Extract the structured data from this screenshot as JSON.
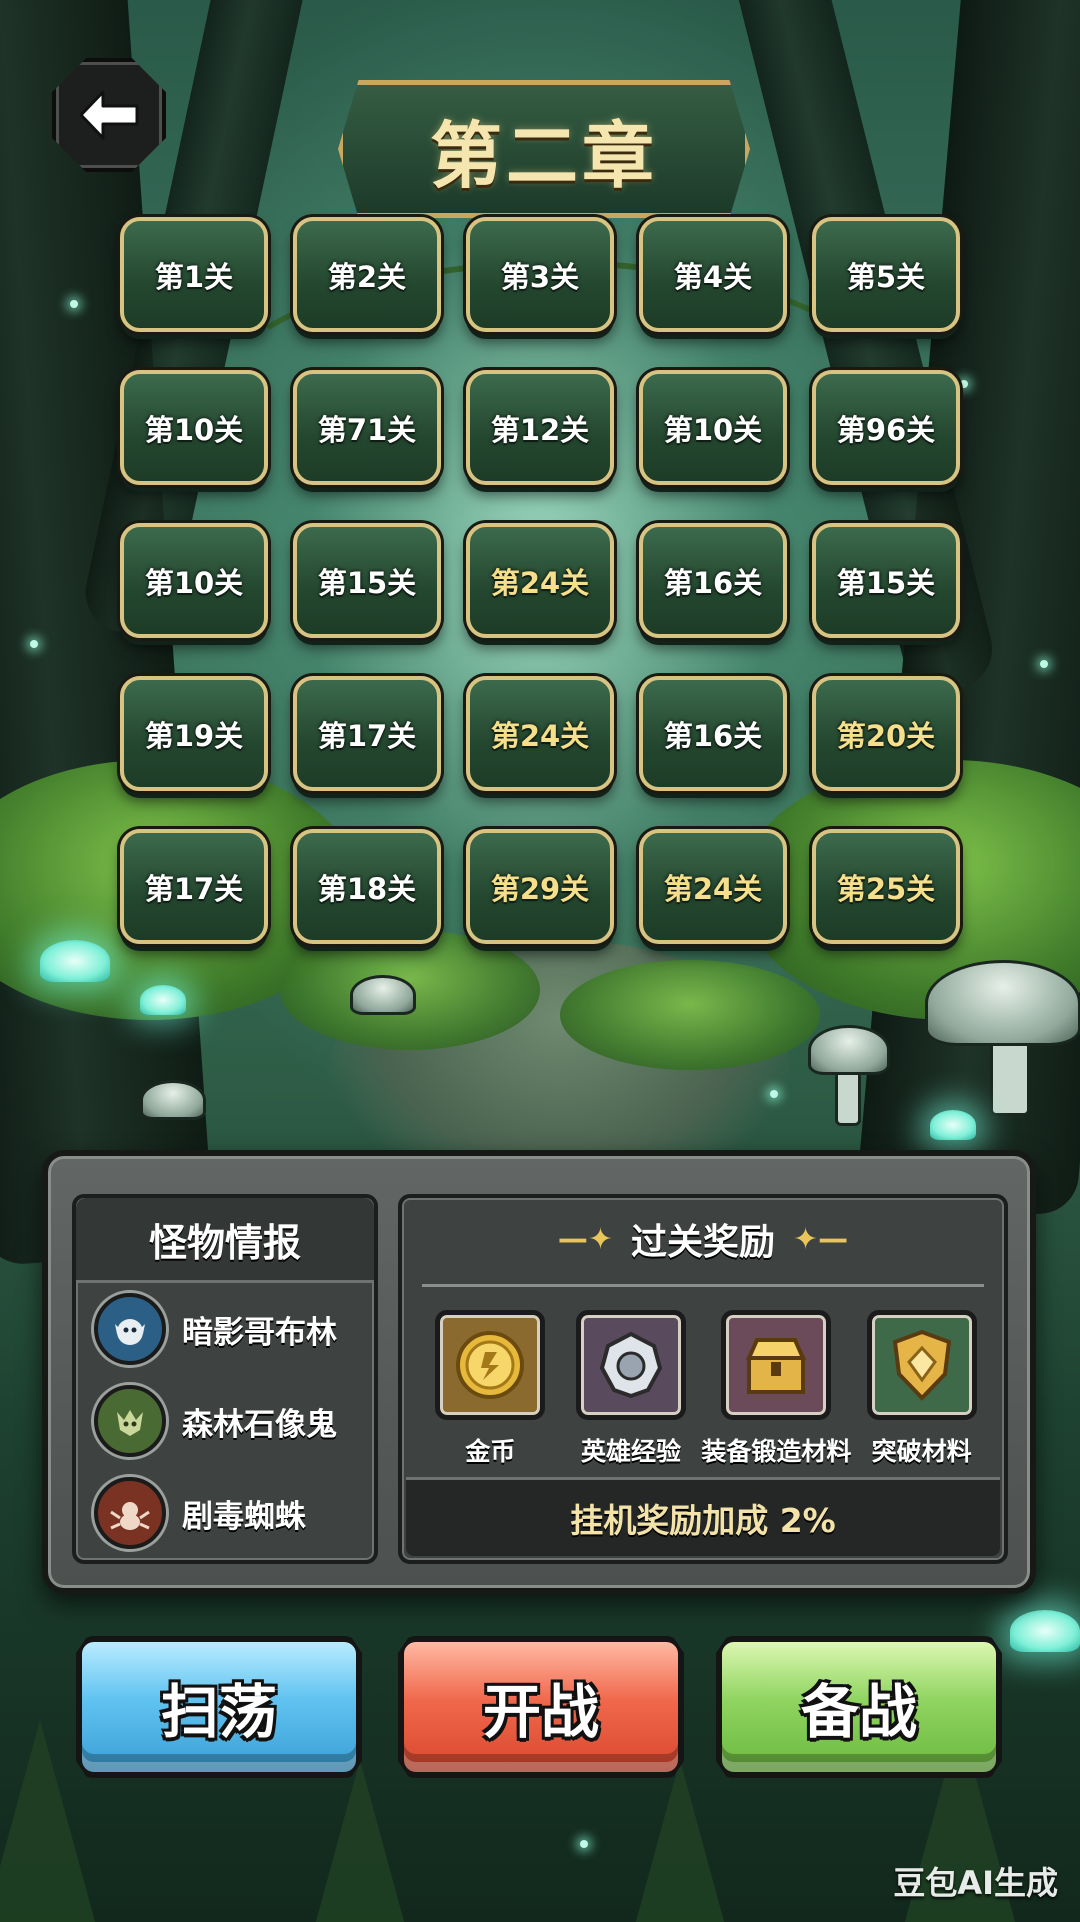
{
  "chapter": {
    "title": "第二章"
  },
  "levels": [
    {
      "label": "第1关",
      "gold": false
    },
    {
      "label": "第2关",
      "gold": false
    },
    {
      "label": "第3关",
      "gold": false
    },
    {
      "label": "第4关",
      "gold": false
    },
    {
      "label": "第5关",
      "gold": false
    },
    {
      "label": "第10关",
      "gold": false
    },
    {
      "label": "第71关",
      "gold": false
    },
    {
      "label": "第12关",
      "gold": false
    },
    {
      "label": "第10关",
      "gold": false
    },
    {
      "label": "第96关",
      "gold": false
    },
    {
      "label": "第10关",
      "gold": false
    },
    {
      "label": "第15关",
      "gold": false
    },
    {
      "label": "第24关",
      "gold": true
    },
    {
      "label": "第16关",
      "gold": false
    },
    {
      "label": "第15关",
      "gold": false
    },
    {
      "label": "第19关",
      "gold": false
    },
    {
      "label": "第17关",
      "gold": false
    },
    {
      "label": "第24关",
      "gold": true
    },
    {
      "label": "第16关",
      "gold": false
    },
    {
      "label": "第20关",
      "gold": true
    },
    {
      "label": "第17关",
      "gold": false
    },
    {
      "label": "第18关",
      "gold": false
    },
    {
      "label": "第29关",
      "gold": true
    },
    {
      "label": "第24关",
      "gold": true
    },
    {
      "label": "第25关",
      "gold": true
    }
  ],
  "monster_info": {
    "title": "怪物情报",
    "monsters": [
      {
        "name": "暗影哥布林",
        "icon": "goblin-icon",
        "color": "#2b5f86"
      },
      {
        "name": "森林石像鬼",
        "icon": "gargoyle-icon",
        "color": "#4a6a34"
      },
      {
        "name": "剧毒蜘蛛",
        "icon": "spider-icon",
        "color": "#7a3322"
      }
    ]
  },
  "rewards": {
    "title": "过关奖励",
    "items": [
      {
        "name": "金币",
        "icon": "gold-coin-icon",
        "color": "#8a6a2e"
      },
      {
        "name": "英雄经验",
        "icon": "hero-exp-icon",
        "color": "#5a4a5e"
      },
      {
        "name": "装备锻造材料",
        "icon": "treasure-chest-icon",
        "color": "#6b4a5a"
      },
      {
        "name": "突破材料",
        "icon": "shield-crystal-icon",
        "color": "#3e6a4a"
      }
    ],
    "bonus": "挂机奖励加成 2%"
  },
  "actions": {
    "sweep": "扫荡",
    "fight": "开战",
    "prepare": "备战"
  },
  "watermark": "豆包AI生成"
}
